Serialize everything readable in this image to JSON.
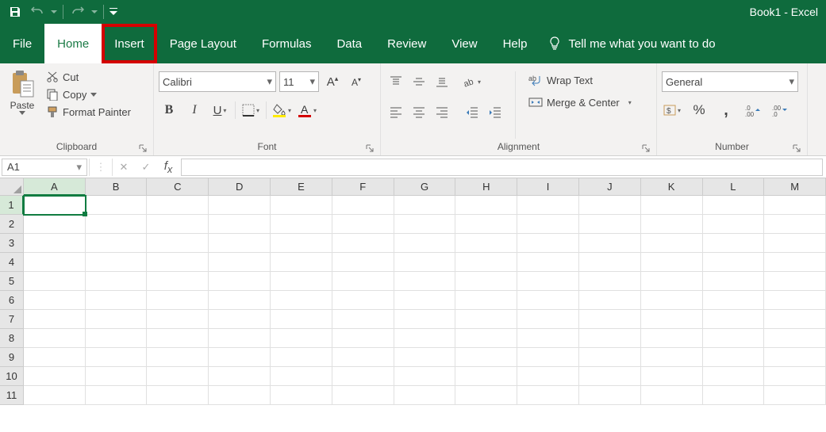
{
  "title": "Book1  -  Excel",
  "tabs": {
    "file": "File",
    "home": "Home",
    "insert": "Insert",
    "page_layout": "Page Layout",
    "formulas": "Formulas",
    "data": "Data",
    "review": "Review",
    "view": "View",
    "help": "Help"
  },
  "tellme": "Tell me what you want to do",
  "ribbon": {
    "clipboard": {
      "paste": "Paste",
      "cut": "Cut",
      "copy": "Copy",
      "format_painter": "Format Painter",
      "label": "Clipboard"
    },
    "font": {
      "name": "Calibri",
      "size": "11",
      "label": "Font"
    },
    "alignment": {
      "wrap": "Wrap Text",
      "merge": "Merge & Center",
      "label": "Alignment"
    },
    "number": {
      "format": "General",
      "label": "Number"
    }
  },
  "name_box": "A1",
  "columns": [
    "A",
    "B",
    "C",
    "D",
    "E",
    "F",
    "G",
    "H",
    "I",
    "J",
    "K",
    "L",
    "M"
  ],
  "rows": [
    "1",
    "2",
    "3",
    "4",
    "5",
    "6",
    "7",
    "8",
    "9",
    "10",
    "11"
  ]
}
